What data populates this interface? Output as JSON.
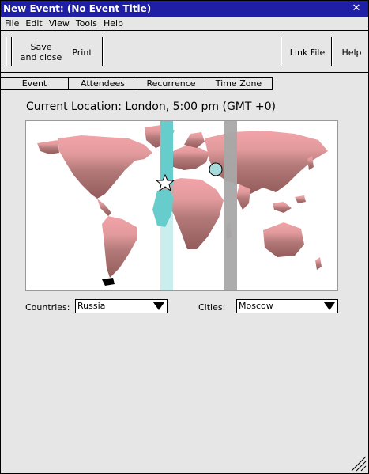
{
  "window": {
    "title": "New Event: (No Event Title)",
    "close_glyph": "✕"
  },
  "menu": {
    "items": [
      "File",
      "Edit",
      "View",
      "Tools",
      "Help"
    ]
  },
  "toolbar": {
    "save_line1": "Save",
    "save_line2": "and close",
    "print": "Print",
    "link_file": "Link File",
    "help": "Help"
  },
  "tabs": [
    "Event",
    "Attendees",
    "Recurrence",
    "Time Zone"
  ],
  "location_text": "Current Location: London, 5:00 pm (GMT +0)",
  "map": {
    "north_color": "#f0a0a4",
    "south_color": "#9a6060",
    "gmt_band_color": "#66cccc",
    "other_band_color": "#a8a8a8",
    "marker_icon": "star-icon",
    "city_marker_icon": "circle-marker-icon"
  },
  "countries": {
    "label": "Countries:",
    "selected": "Russia"
  },
  "cities": {
    "label": "Cities:",
    "selected": "Moscow"
  }
}
